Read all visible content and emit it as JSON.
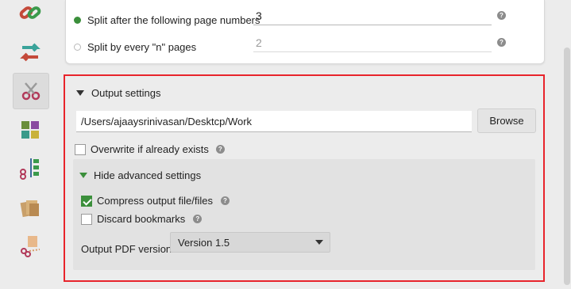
{
  "toolbar": {
    "tools": [
      {
        "icon": "chain-link-icon"
      },
      {
        "icon": "rotate-arrows-icon"
      },
      {
        "icon": "scissors-icon",
        "selected": true
      },
      {
        "icon": "compress-arrows-icon"
      },
      {
        "icon": "tree-scissors-icon"
      },
      {
        "icon": "stack-pages-icon"
      },
      {
        "icon": "cut-pages-icon"
      }
    ]
  },
  "split_options": {
    "after_pages": {
      "label": "Split after the following page numbers",
      "value": "3",
      "selected": true
    },
    "every_n": {
      "label": "Split by every \"n\" pages",
      "value": "2",
      "selected": false
    }
  },
  "output": {
    "section_title": "Output settings",
    "destination": "/Users/ajaaysrinivasan/Desktcp/Work",
    "browse_label": "Browse",
    "overwrite_label": "Overwrite if already exists",
    "overwrite_checked": false,
    "advanced": {
      "toggle_label": "Hide advanced settings",
      "compress_label": "Compress output file/files",
      "compress_checked": true,
      "discard_label": "Discard bookmarks",
      "discard_checked": false,
      "version_label": "Output PDF version:",
      "version_value": "Version 1.5"
    }
  },
  "help_glyph": "?",
  "colors": {
    "accent_green": "#3b8f3b",
    "highlight_red": "#e8242b"
  }
}
